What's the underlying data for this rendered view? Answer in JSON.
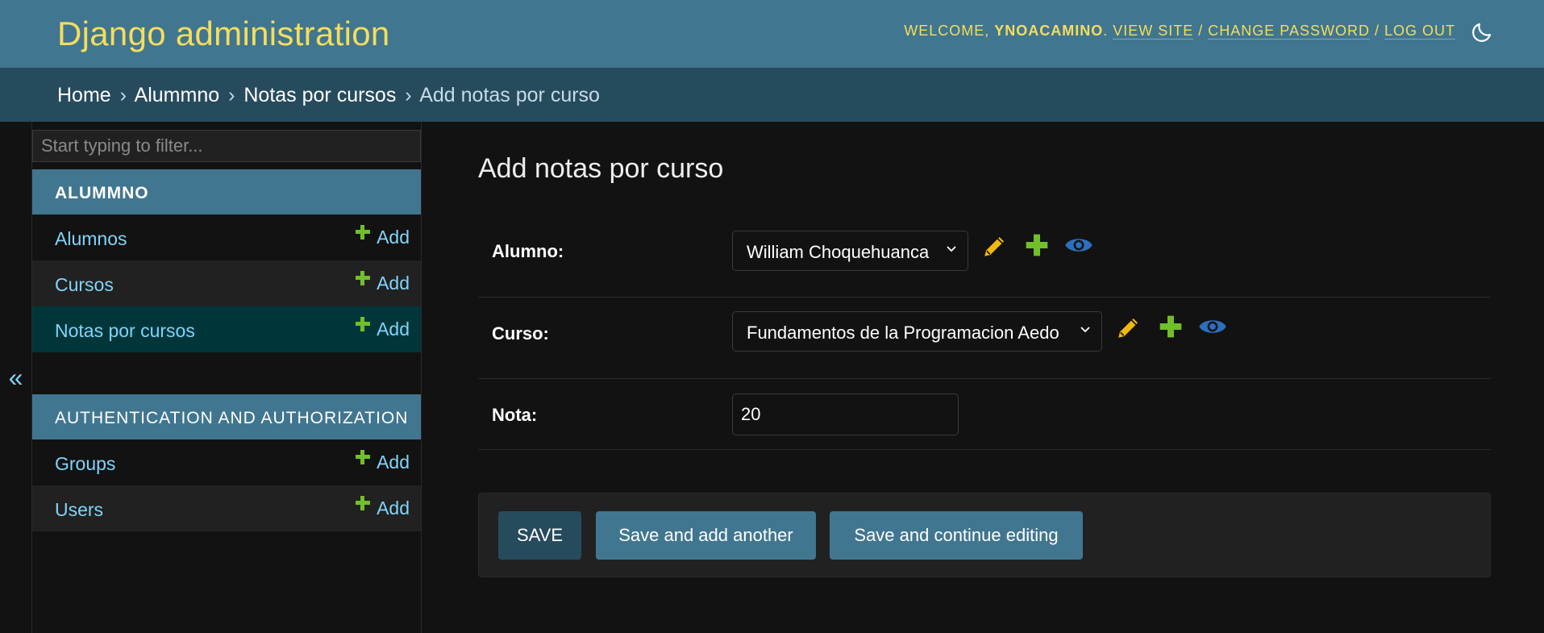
{
  "header": {
    "site_name": "Django administration",
    "welcome": "Welcome, ",
    "username": "ynoacamino",
    "view_site": "View site",
    "change_password": "Change password",
    "log_out": "Log out",
    "separator": " / ",
    "period": ". "
  },
  "breadcrumbs": {
    "home": "Home",
    "app": "Alummno",
    "model": "Notas por cursos",
    "current": "Add notas por curso",
    "separator": "›"
  },
  "sidebar": {
    "toggle": "«",
    "filter_placeholder": "Start typing to filter...",
    "apps": [
      {
        "name": "ALUMMNO",
        "models": [
          {
            "name": "Alumnos",
            "add": "Add"
          },
          {
            "name": "Cursos",
            "add": "Add"
          },
          {
            "name": "Notas por cursos",
            "add": "Add"
          }
        ]
      },
      {
        "name": "AUTHENTICATION AND AUTHORIZATION",
        "models": [
          {
            "name": "Groups",
            "add": "Add"
          },
          {
            "name": "Users",
            "add": "Add"
          }
        ]
      }
    ]
  },
  "content": {
    "title": "Add notas por curso",
    "fields": {
      "alumno": {
        "label": "Alumno:",
        "value": "William Choquehuanca"
      },
      "curso": {
        "label": "Curso:",
        "value": "Fundamentos de la Programacion Aedo"
      },
      "nota": {
        "label": "Nota:",
        "value": "20"
      }
    }
  },
  "submit": {
    "save": "SAVE",
    "save_add_another": "Save and add another",
    "save_continue": "Save and continue editing"
  },
  "colors": {
    "header_bg": "#417690",
    "breadcrumbs_bg": "#264b5d",
    "accent_yellow": "#f5dd5d",
    "link_blue": "#81d4fa",
    "add_green": "#70bf2b",
    "edit_yellow": "#efb80b",
    "view_blue": "#2b70bf"
  },
  "icons": {
    "theme": "moon-icon",
    "edit": "pencil-icon",
    "add": "plus-icon",
    "view": "eye-icon"
  }
}
